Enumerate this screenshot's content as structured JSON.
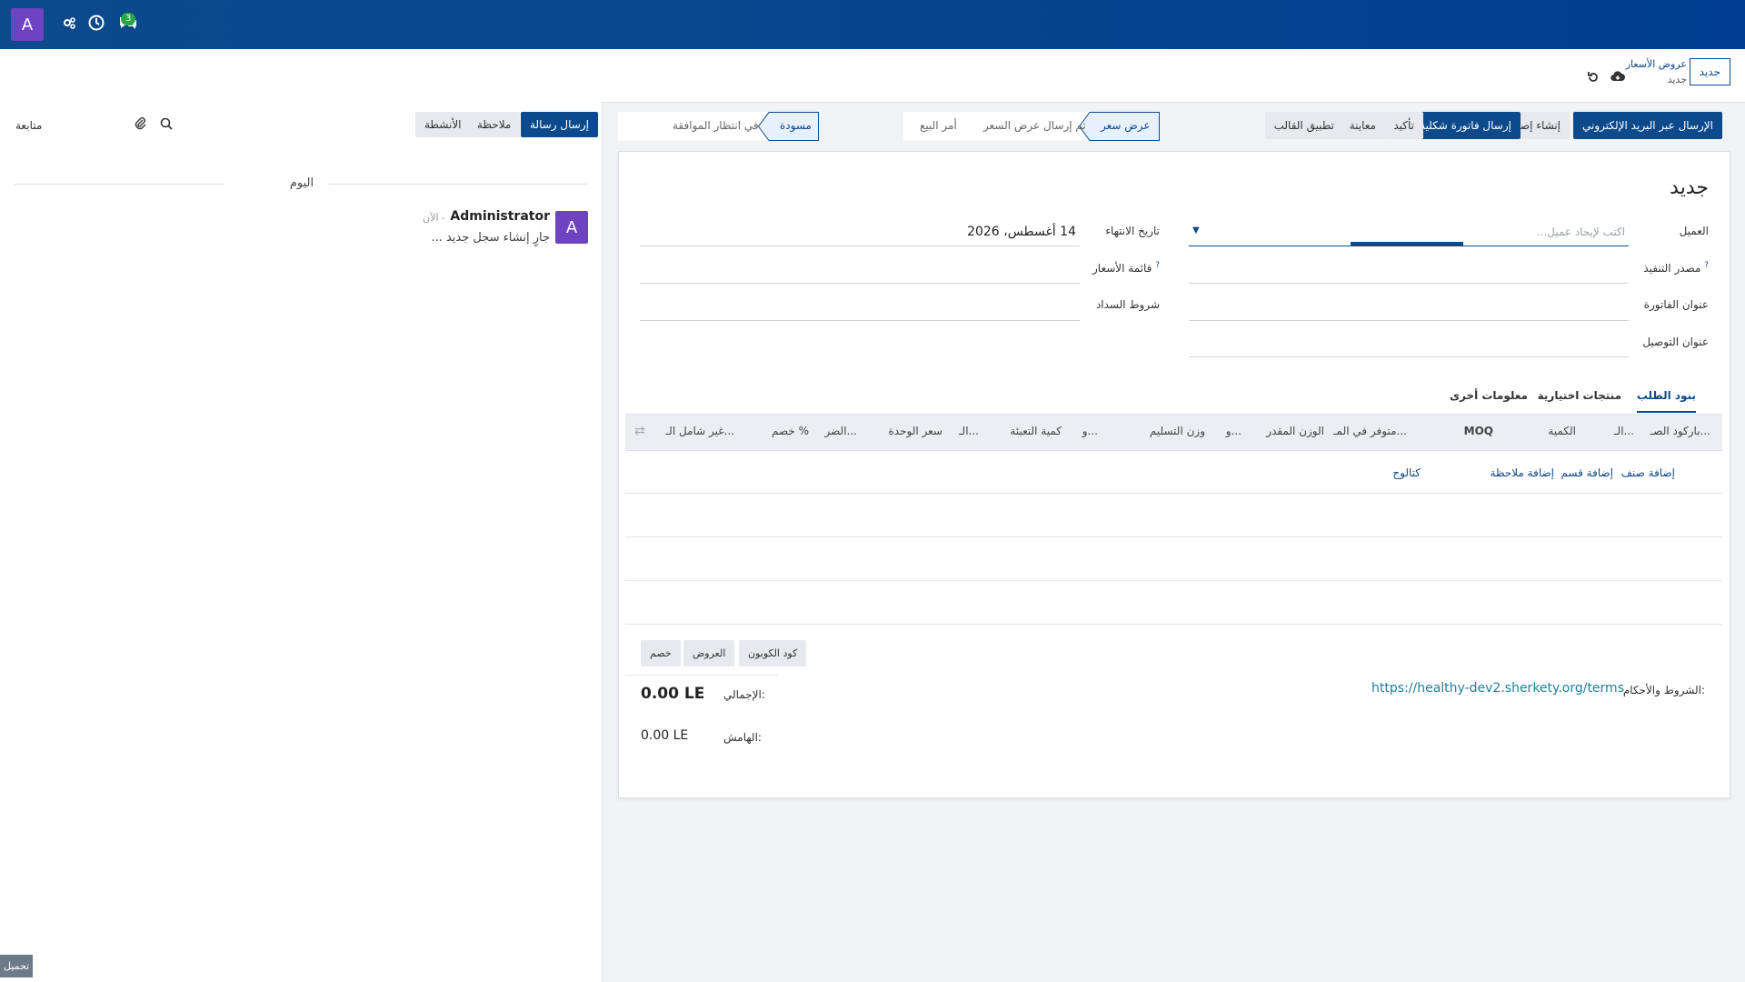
{
  "navbar": {
    "user_initial": "A",
    "messages_badge": "3"
  },
  "control_panel": {
    "new_button": "جديد",
    "breadcrumb_parent": "عروض الأسعار",
    "breadcrumb_current": "جديد"
  },
  "form_header": {
    "buttons": {
      "send_email": "الإرسال عبر البريد الإلكتروني",
      "create_issue": "إنشاء إصدار",
      "proforma_invoice": "إرسال فاتورة شكلية",
      "confirm": "تأكيد",
      "preview": "معاينة",
      "apply_template": "تطبيق القالب"
    },
    "stages_sale": [
      "عرض سعر",
      "تم إرسال عرض السعر",
      "أمر البيع"
    ],
    "stages_approval": [
      "مسودة",
      "في انتظار الموافقة"
    ]
  },
  "chatter": {
    "send_message": "إرسال رسالة",
    "log_note": "ملاحظة",
    "activities": "الأنشطة",
    "follow": "متابعة",
    "date_separator": "اليوم",
    "message": {
      "author": "Administrator",
      "time": "- الآن",
      "body": "جارٍ إنشاء سجل جديد ...",
      "avatar_initial": "A"
    },
    "upload_button": "تحميل"
  },
  "form": {
    "title": "جديد",
    "customer_label": "العميل",
    "customer_placeholder": "اكتب لإيجاد عميل...",
    "execution_source_label": "مصدر التنفيذ",
    "invoice_address_label": "عنوان الفاتورة",
    "delivery_address_label": "عنوان التوصيل",
    "expiration_label": "تاريخ الانتهاء",
    "expiration_value": "14 أغسطس، 2026",
    "pricelist_label": "قائمة الأسعار",
    "payment_terms_label": "شروط السداد",
    "help_mark": "?"
  },
  "tabs": [
    "بنود الطلب",
    "منتجات اختيارية",
    "معلومات أخرى"
  ],
  "order_lines": {
    "columns": [
      "باركود الصـ...",
      "الـ...",
      "الكمية",
      "MOQ",
      "متوفر في المـ...",
      "الوزن المقدر",
      "و...",
      "وزن التسليم",
      "و...",
      "كمية التعبئة",
      "الـ...",
      "سعر الوحدة",
      "الضر...",
      "خصم %",
      "غير شامل الـ..."
    ],
    "add_links": [
      "إضافة صنف",
      "إضافة قسم",
      "إضافة ملاحظة",
      "كتالوج"
    ]
  },
  "promo_buttons": [
    "كود الكوبون",
    "العروض",
    "خصم"
  ],
  "totals": {
    "total_label": "الإجمالي:",
    "total_value": "0.00 LE",
    "margin_label": "الهامش:",
    "margin_value": "0.00 LE"
  },
  "terms": {
    "label": "الشروط والأحكام:",
    "url": "https://healthy-dev2.sherkety.org/terms"
  },
  "colors": {
    "navbar": "#0d4a8c",
    "primary": "#0d4a8c",
    "avatar": "#6f42c1",
    "badge": "#28a745"
  }
}
